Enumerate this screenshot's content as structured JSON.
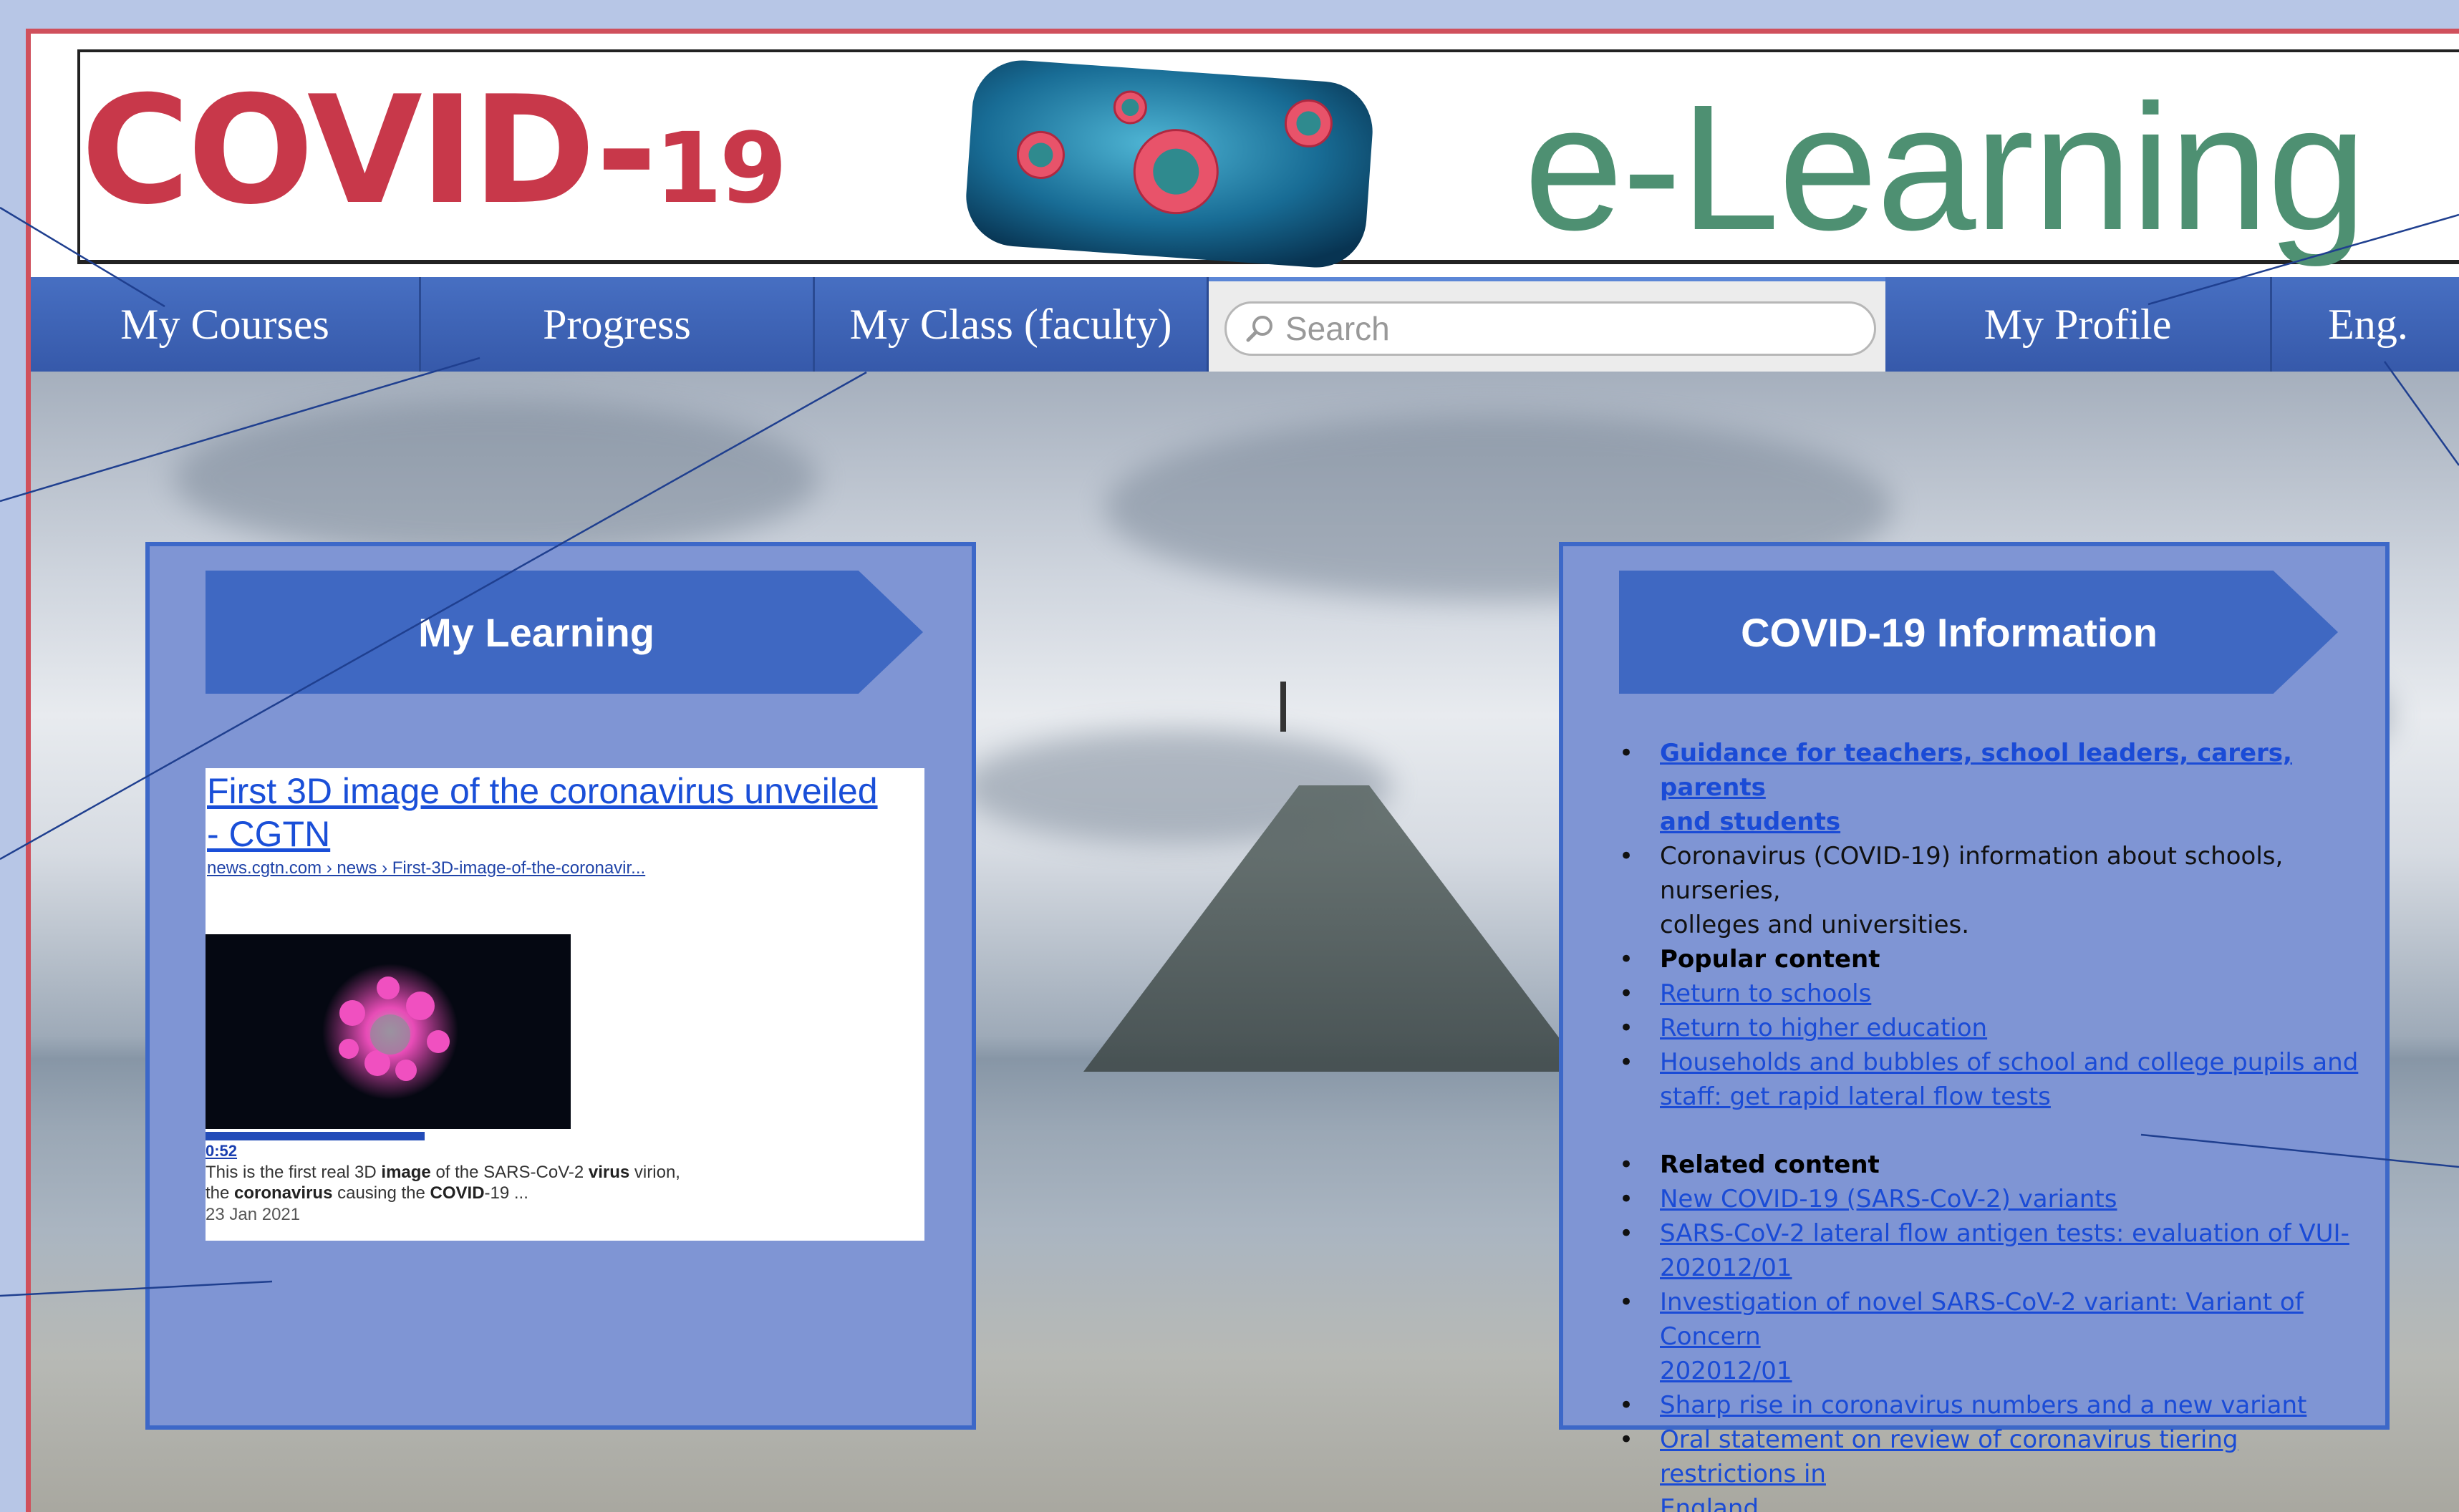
{
  "banner": {
    "covid_title": "COVID-",
    "covid_number": "19",
    "elearning_title": "e-Learning"
  },
  "nav": {
    "items": [
      {
        "label": "My Courses"
      },
      {
        "label": "Progress"
      },
      {
        "label": "My Class (faculty)"
      },
      {
        "label": "My Profile"
      },
      {
        "label": "Eng."
      }
    ],
    "search": {
      "placeholder": "Search"
    }
  },
  "my_learning": {
    "title": "My Learning",
    "result": {
      "title_line1": "First 3D image of the coronavirus unveiled",
      "title_line2": "- CGTN",
      "url": "news.cgtn.com › news › First-3D-image-of-the-coronavir...",
      "video_time": "0:52",
      "snippet_1": "This is the first real 3D ",
      "snippet_1b": "image",
      "snippet_1c": " of the SARS-CoV-2 ",
      "snippet_1d": "virus",
      "snippet_1e": " virion,",
      "snippet_2a": "the ",
      "snippet_2b": "coronavirus",
      "snippet_2c": " causing the ",
      "snippet_2d": "COVID",
      "snippet_2e": "-19 ...",
      "date": "23 Jan 2021"
    }
  },
  "covid_info": {
    "title": "COVID-19 Information",
    "guidance_link_1": "Guidance for teachers, school leaders, carers, parents",
    "guidance_link_2": "and students",
    "info_text_1": "Coronavirus (COVID-19) information about schools, nurseries,",
    "info_text_2": "colleges and universities.",
    "popular_heading": "Popular content",
    "popular_1": "Return to schools",
    "popular_2": "Return to higher education",
    "popular_3a": "Households and bubbles of school and college pupils and",
    "popular_3b": "staff: get rapid lateral flow tests",
    "related_heading": "Related content",
    "related_1": "New COVID-19 (SARS-CoV-2) variants",
    "related_2a": "SARS-CoV-2 lateral flow antigen tests: evaluation of VUI-",
    "related_2b": "202012/01",
    "related_3a": "Investigation of novel SARS-CoV-2 variant: Variant of Concern",
    "related_3b": "202012/01",
    "related_4": "Sharp rise in coronavirus numbers and a new variant",
    "related_5a": "Oral statement on review of coronavirus tiering restrictions in",
    "related_5b": "England"
  },
  "colors": {
    "covid_red": "#c8384a",
    "elearning_green": "#4e9072",
    "nav_blue": "#3a62b6",
    "panel_fill": "#7f95d4",
    "link_blue": "#1a4bd6"
  }
}
